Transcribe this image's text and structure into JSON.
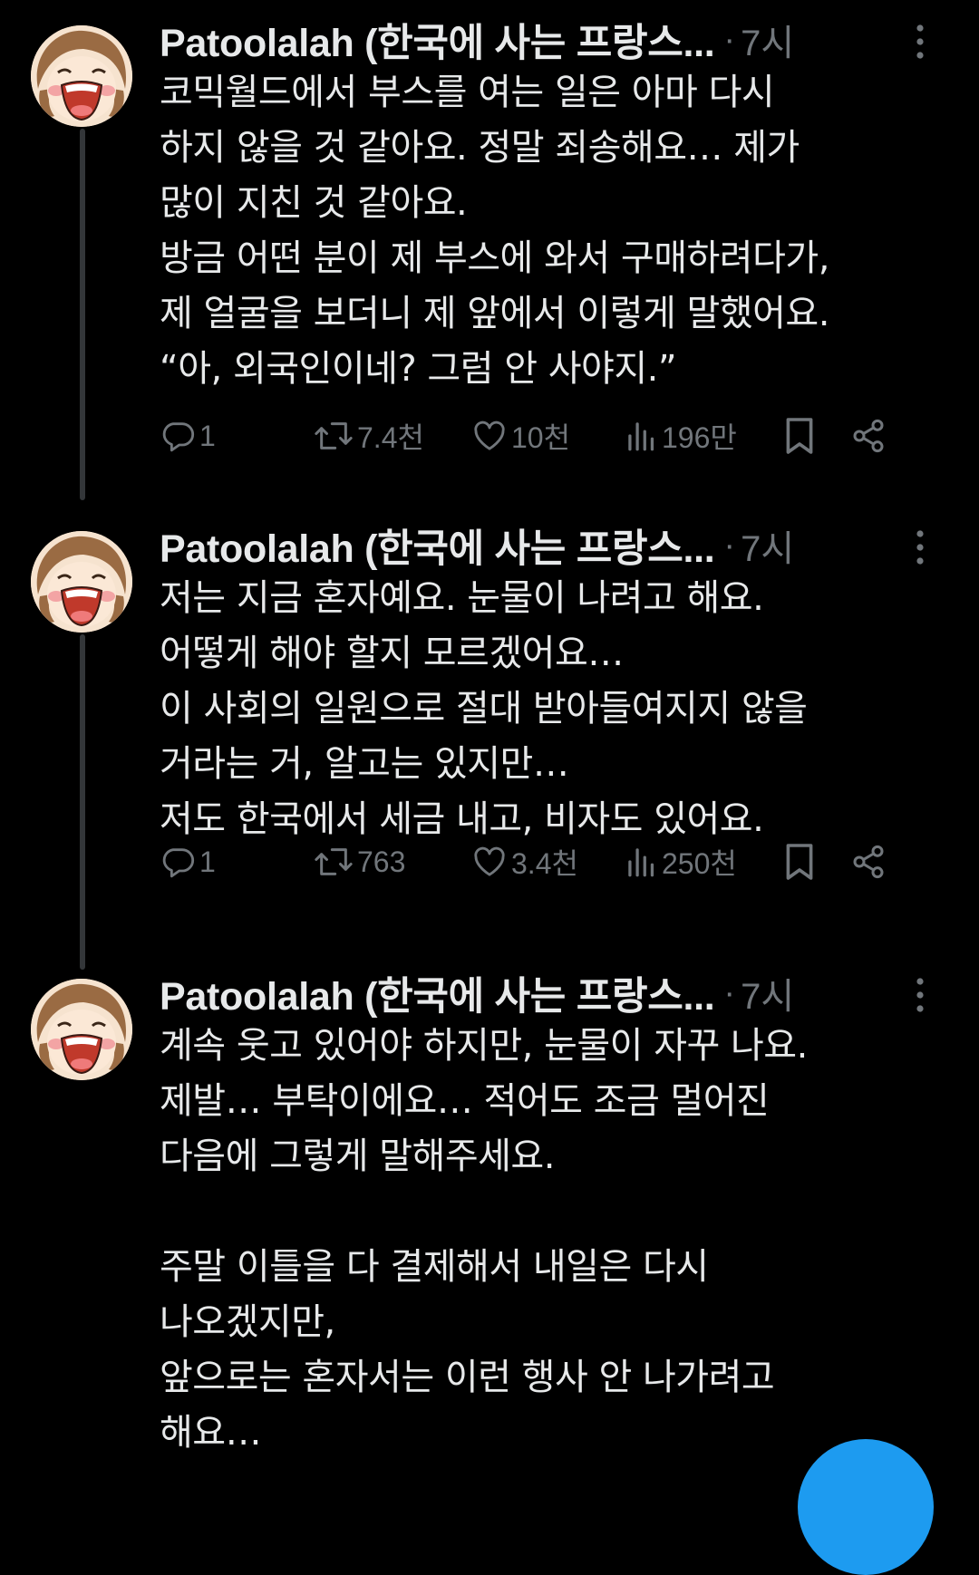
{
  "colors": {
    "background": "#000000",
    "text": "#e7e9ea",
    "muted": "#71767b",
    "thread_line": "#333639",
    "accent": "#1d9bf0"
  },
  "tweets": [
    {
      "author": "Patoolalah (한국에 사는 프랑스...",
      "separator": "·",
      "time": "7시",
      "text": "코믹월드에서 부스를 여는 일은 아마 다시\n하지 않을 것 같아요. 정말 죄송해요… 제가\n많이 지친 것 같아요.\n방금 어떤 분이 제 부스에 와서 구매하려다가,\n제 얼굴을 보더니 제 앞에서 이렇게 말했어요.\n“아, 외국인이네? 그럼 안 사야지.”",
      "replies": "1",
      "reposts": "7.4천",
      "likes": "10천",
      "views": "196만"
    },
    {
      "author": "Patoolalah (한국에 사는 프랑스...",
      "separator": "·",
      "time": "7시",
      "text": "저는 지금 혼자예요. 눈물이 나려고 해요.\n어떻게 해야 할지 모르겠어요…\n이 사회의 일원으로 절대 받아들여지지 않을\n거라는 거, 알고는 있지만…\n저도 한국에서 세금 내고, 비자도 있어요.",
      "replies": "1",
      "reposts": "763",
      "likes": "3.4천",
      "views": "250천"
    },
    {
      "author": "Patoolalah (한국에 사는 프랑스...",
      "separator": "·",
      "time": "7시",
      "text": "계속 웃고 있어야 하지만, 눈물이 자꾸 나요.\n제발… 부탁이에요… 적어도 조금 멀어진\n다음에 그렇게 말해주세요.\n\n주말 이틀을 다 결제해서 내일은 다시\n나오겠지만,\n앞으로는 혼자서는 이런 행사 안 나가려고\n해요…"
    }
  ],
  "icons": {
    "avatar": "cartoon-avatar-icon",
    "more": "more-options-icon",
    "reply": "reply-icon",
    "repost": "repost-icon",
    "like": "heart-icon",
    "views": "views-icon",
    "bookmark": "bookmark-icon",
    "share": "share-icon",
    "compose": "compose-fab"
  }
}
